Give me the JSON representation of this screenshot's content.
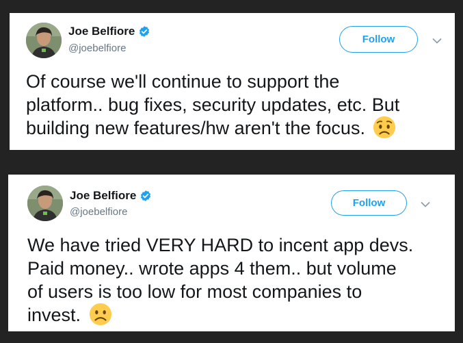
{
  "colors": {
    "background": "#232323",
    "card": "#ffffff",
    "accent": "#1da1f2",
    "text": "#14171a",
    "secondary": "#657786"
  },
  "tweets": [
    {
      "author": {
        "name": "Joe Belfiore",
        "handle": "@joebelfiore",
        "verified": true
      },
      "follow_label": "Follow",
      "lines": [
        "Of course we'll continue to support the",
        "platform.. bug fixes, security updates, etc. But",
        "building new features/hw aren't the focus."
      ],
      "emoji": "worried-face"
    },
    {
      "author": {
        "name": "Joe Belfiore",
        "handle": "@joebelfiore",
        "verified": true
      },
      "follow_label": "Follow",
      "lines": [
        "We have tried VERY HARD to incent app devs.",
        "Paid money.. wrote apps 4 them.. but volume",
        "of users is too low for most companies to",
        "invest."
      ],
      "emoji": "slightly-frowning-face"
    }
  ]
}
